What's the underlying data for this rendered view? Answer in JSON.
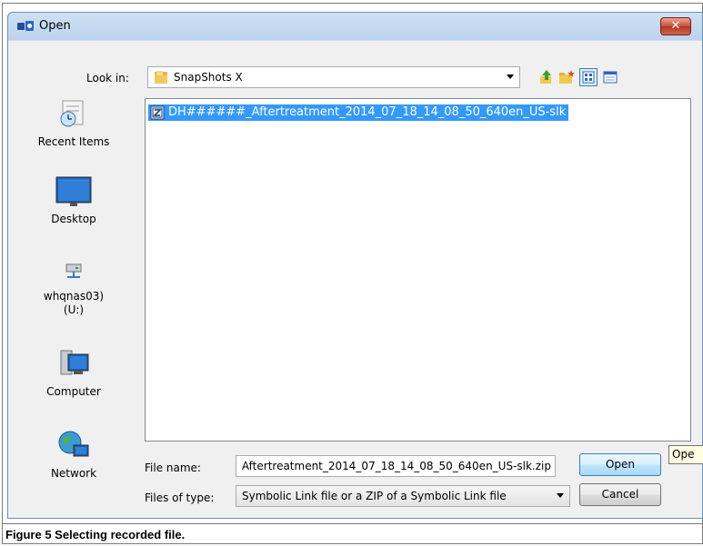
{
  "window": {
    "title": "Open"
  },
  "titlebar": {
    "close_label": "✕"
  },
  "look_in": {
    "label": "Look in:",
    "value": "SnapShots X"
  },
  "places": [
    {
      "label": "Recent Items",
      "icon": "recent-items-icon"
    },
    {
      "label": "Desktop",
      "icon": "desktop-icon"
    },
    {
      "label": "whqnas03)\n(U:)",
      "icon": "network-drive-icon"
    },
    {
      "label": "Computer",
      "icon": "computer-icon"
    },
    {
      "label": "Network",
      "icon": "network-globe-icon"
    }
  ],
  "files": [
    {
      "name": "DH######_Aftertreatment_2014_07_18_14_08_50_640en_US-slk",
      "selected": true
    }
  ],
  "file_name": {
    "label": "File name:",
    "value": "Aftertreatment_2014_07_18_14_08_50_640en_US-slk.zip"
  },
  "file_type": {
    "label": "Files of type:",
    "value": "Symbolic Link file or a ZIP of a Symbolic Link file"
  },
  "buttons": {
    "open": "Open",
    "cancel": "Cancel"
  },
  "tooltip": "Ope",
  "caption": "Figure 5 Selecting recorded file.",
  "colors": {
    "selection": "#3399ff",
    "tooltip_bg": "#ffffe1",
    "close_button": "#c75038"
  }
}
